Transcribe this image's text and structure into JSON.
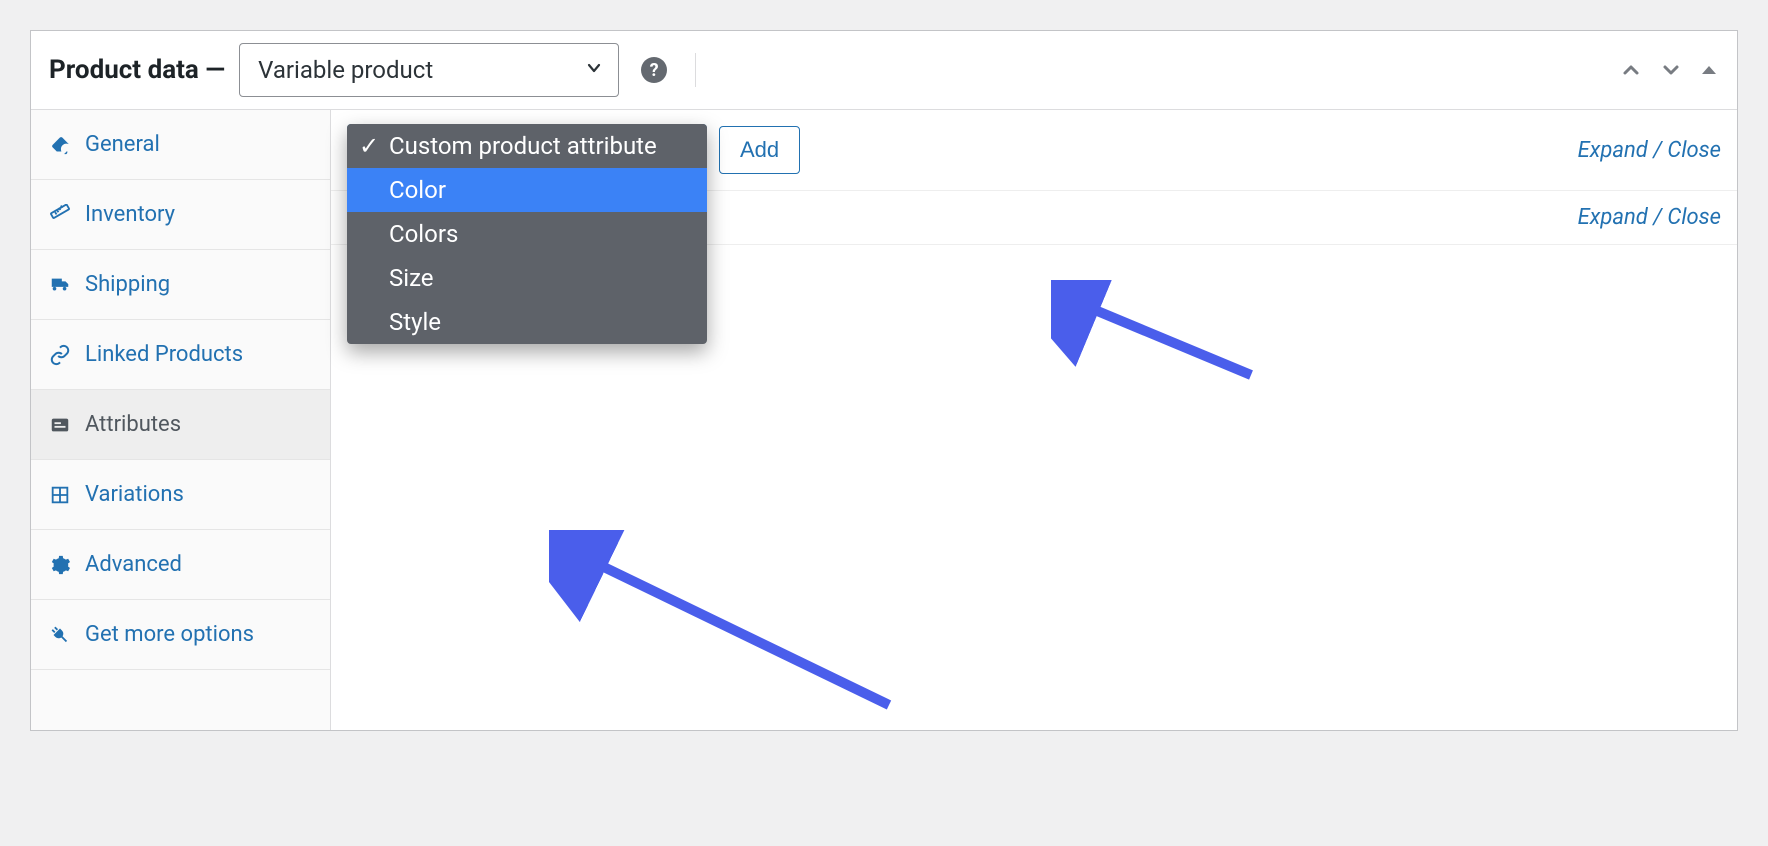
{
  "header": {
    "title": "Product data —",
    "productTypeSelected": "Variable product"
  },
  "sidebar": {
    "items": [
      {
        "label": "General",
        "icon": "wrench"
      },
      {
        "label": "Inventory",
        "icon": "ruler"
      },
      {
        "label": "Shipping",
        "icon": "truck"
      },
      {
        "label": "Linked Products",
        "icon": "link"
      },
      {
        "label": "Attributes",
        "icon": "card"
      },
      {
        "label": "Variations",
        "icon": "grid"
      },
      {
        "label": "Advanced",
        "icon": "gear"
      },
      {
        "label": "Get more options",
        "icon": "plug"
      }
    ],
    "activeIndex": 4
  },
  "content": {
    "addButtonLabel": "Add",
    "expandCloseLabel": "Expand / Close",
    "attributeDropdown": {
      "options": [
        "Custom product attribute",
        "Color",
        "Colors",
        "Size",
        "Style"
      ],
      "checkedIndex": 0,
      "highlightedIndex": 1
    }
  }
}
